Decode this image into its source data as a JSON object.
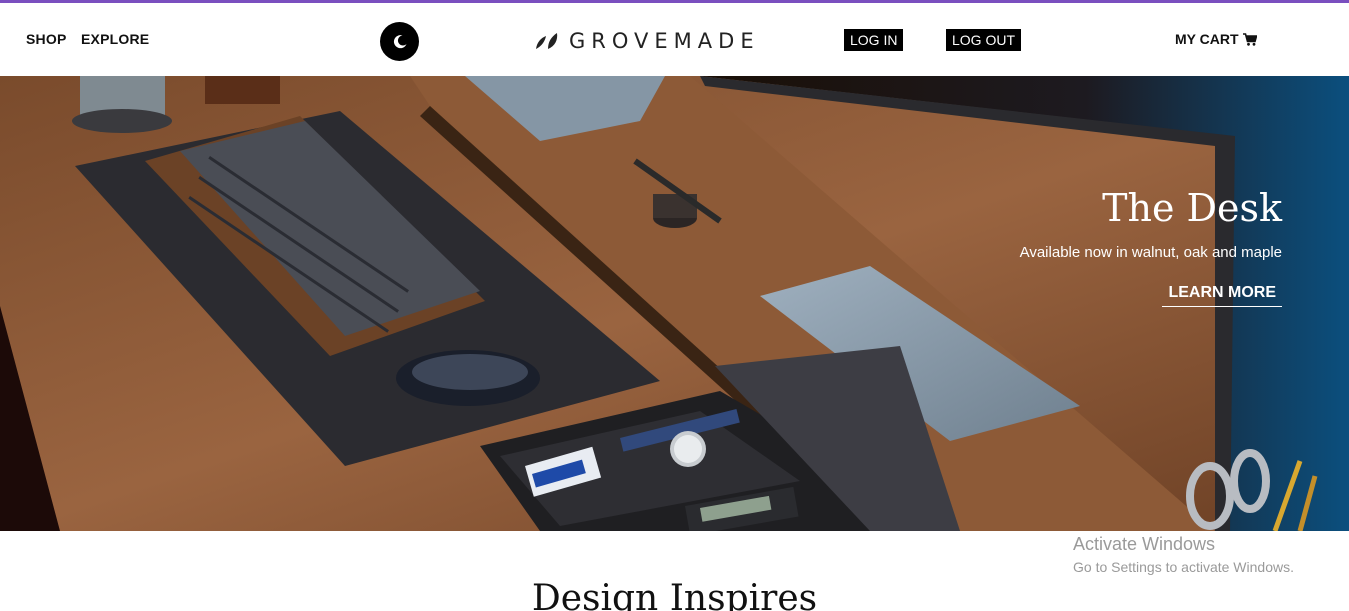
{
  "header": {
    "nav": {
      "shop": "SHOP",
      "explore": "EXPLORE"
    },
    "brand": "GROVEMADE",
    "login_label": "LOG IN",
    "logout_label": "LOG OUT",
    "cart_label": "MY CART",
    "icons": {
      "theme": "moon-icon",
      "logo": "leaf-logo-icon",
      "cart": "cart-icon"
    }
  },
  "hero": {
    "title": "The Desk",
    "subtitle": "Available now in walnut, oak and maple",
    "cta_label": "LEARN MORE"
  },
  "section": {
    "heading": "Design Inspires"
  },
  "overlay": {
    "title": "Activate Windows",
    "subtitle": "Go to Settings to activate Windows."
  },
  "colors": {
    "accent_bar": "#7a4fbf",
    "button_bg": "#000000"
  }
}
